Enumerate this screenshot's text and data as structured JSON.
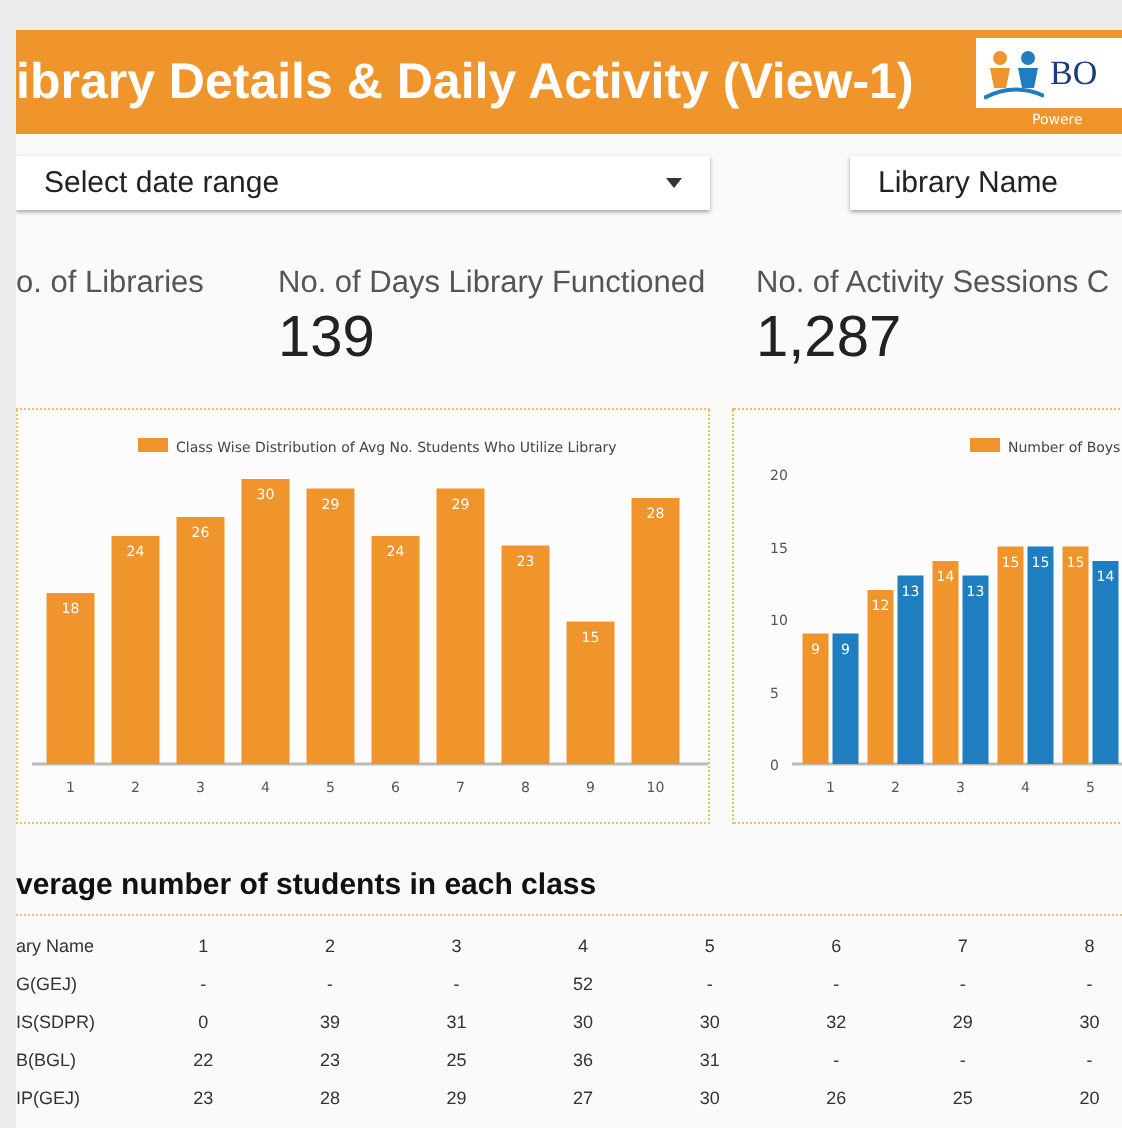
{
  "header": {
    "title": "ibrary Details & Daily Activity (View-1)",
    "logo_text": "BO",
    "logo_caption": "Powere"
  },
  "filters": [
    {
      "label": "Select date range",
      "kind": "dropdown"
    },
    {
      "label": "Library Name",
      "kind": "field"
    }
  ],
  "kpis": [
    {
      "label": "o. of Libraries"
    },
    {
      "label": "No. of Days Library Functioned",
      "value": "139"
    },
    {
      "label": "No. of Activity Sessions C",
      "value": "1,287"
    }
  ],
  "charts": [
    {
      "chart_data": {
        "type": "bar",
        "categories": [
          "1",
          "2",
          "3",
          "4",
          "5",
          "6",
          "7",
          "8",
          "9",
          "10"
        ],
        "series": [
          {
            "name": "Class Wise Distribution of Avg No. Students Who Utilize Library",
            "color": "#f0942c",
            "values": [
              18,
              24,
              26,
              30,
              29,
              24,
              29,
              23,
              15,
              28
            ]
          }
        ],
        "ylim": [
          0,
          30
        ],
        "data_labels": true
      }
    },
    {
      "chart_data": {
        "type": "bar",
        "categories": [
          "1",
          "2",
          "3",
          "4",
          "5"
        ],
        "series": [
          {
            "name": "Number of Boys",
            "color": "#f0942c",
            "values": [
              9,
              12,
              14,
              15,
              15
            ]
          },
          {
            "color": "#1f7ec0",
            "values": [
              9,
              13,
              13,
              15,
              14
            ]
          }
        ],
        "ylim": [
          0,
          20
        ],
        "yticks": [
          0,
          5,
          10,
          15,
          20
        ],
        "data_labels": true
      }
    }
  ],
  "table": {
    "title": "verage number of students in each class",
    "columns": [
      "ary Name",
      "1",
      "2",
      "3",
      "4",
      "5",
      "6",
      "7",
      "8"
    ],
    "rows": [
      [
        "G(GEJ)",
        "-",
        "-",
        "-",
        "52",
        "-",
        "-",
        "-",
        "-"
      ],
      [
        "IS(SDPR)",
        "0",
        "39",
        "31",
        "30",
        "30",
        "32",
        "29",
        "30"
      ],
      [
        "B(BGL)",
        "22",
        "23",
        "25",
        "36",
        "31",
        "-",
        "-",
        "-"
      ],
      [
        "IP(GEJ)",
        "23",
        "28",
        "29",
        "27",
        "30",
        "26",
        "25",
        "20"
      ]
    ]
  }
}
